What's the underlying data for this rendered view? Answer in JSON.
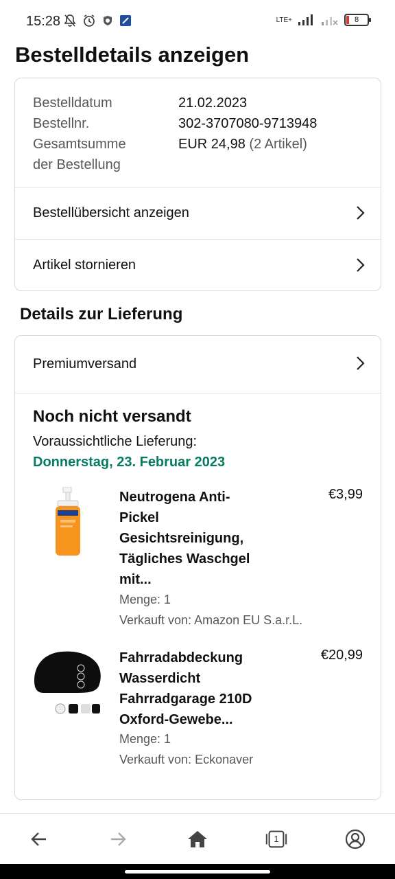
{
  "status_bar": {
    "time": "15:28",
    "network": "LTE+",
    "battery": "8"
  },
  "page": {
    "title": "Bestelldetails anzeigen"
  },
  "summary": {
    "rows": [
      {
        "label": "Bestelldatum",
        "value": "21.02.2023"
      },
      {
        "label": "Bestellnr.",
        "value": "302-3707080-9713948"
      }
    ],
    "total_label_line1": "Gesamtsumme",
    "total_label_line2": "der Bestellung",
    "total_value": "EUR 24,98",
    "total_items": "(2 Artikel)",
    "links": [
      {
        "label": "Bestellübersicht anzeigen"
      },
      {
        "label": "Artikel stornieren"
      }
    ]
  },
  "delivery": {
    "section_title": "Details zur Lieferung",
    "shipping_method": "Premiumversand",
    "status": "Noch nicht versandt",
    "expected_label": "Voraussichtliche Lieferung:",
    "expected_date": "Donnerstag, 23. Februar 2023",
    "items": [
      {
        "title_lines": [
          "Neutrogena Anti-",
          "Pickel",
          "Gesichtsreinigung,",
          "Tägliches Waschgel",
          "mit..."
        ],
        "price": "€3,99",
        "quantity": "Menge: 1",
        "seller": "Verkauft von: Amazon EU S.a.r.L."
      },
      {
        "title_lines": [
          "Fahrradabdeckung",
          "Wasserdicht",
          "Fahrradgarage 210D",
          "Oxford-Gewebe..."
        ],
        "price": "€20,99",
        "quantity": "Menge: 1",
        "seller": "Verkauft von: Eckonaver"
      }
    ]
  },
  "bottom_nav": {
    "icons": [
      "back-arrow-icon",
      "forward-arrow-icon",
      "home-icon",
      "tabs-icon",
      "account-icon"
    ],
    "tab_count": "1"
  }
}
